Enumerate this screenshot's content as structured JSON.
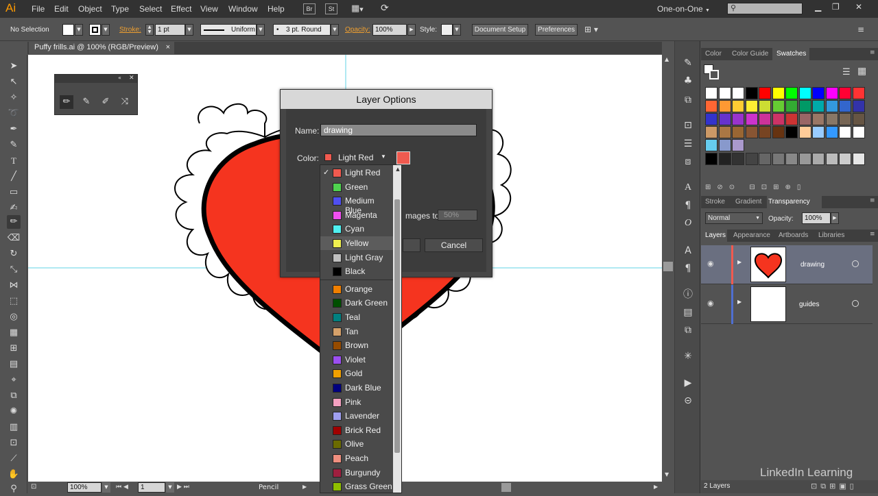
{
  "app": {
    "logo": "Ai"
  },
  "menu": [
    "File",
    "Edit",
    "Object",
    "Type",
    "Select",
    "Effect",
    "View",
    "Window",
    "Help"
  ],
  "menu_badges": [
    "Br",
    "St"
  ],
  "workspace": "One-on-One",
  "control": {
    "selection": "No Selection",
    "stroke_label": "Stroke:",
    "stroke_weight": "1 pt",
    "profile": "Uniform",
    "brush": "3 pt. Round",
    "opacity_label": "Opacity:",
    "opacity": "100%",
    "style_label": "Style:",
    "doc_setup": "Document Setup",
    "preferences": "Preferences"
  },
  "document_tab": {
    "title": "Puffy frills.ai @ 100% (RGB/Preview)",
    "close": "×"
  },
  "dialog": {
    "title": "Layer Options",
    "name_label": "Name:",
    "name_value": "drawing",
    "color_label": "Color:",
    "color_value": "Light Red",
    "color_hex": "#f05a4f",
    "dim_label": "mages to:",
    "dim_value": "50%",
    "cancel": "Cancel"
  },
  "color_list": {
    "selected": "Light Red",
    "hovered": "Yellow",
    "group1": [
      {
        "label": "Light Red",
        "color": "#f05a4f"
      },
      {
        "label": "Green",
        "color": "#4fd34f"
      },
      {
        "label": "Medium Blue",
        "color": "#4f4ff0"
      },
      {
        "label": "Magenta",
        "color": "#f04ff0"
      },
      {
        "label": "Cyan",
        "color": "#4ff0f0"
      },
      {
        "label": "Yellow",
        "color": "#f0f04f"
      },
      {
        "label": "Light Gray",
        "color": "#c0c0c0"
      },
      {
        "label": "Black",
        "color": "#000000"
      }
    ],
    "group2": [
      {
        "label": "Orange",
        "color": "#f07f00"
      },
      {
        "label": "Dark Green",
        "color": "#004f00"
      },
      {
        "label": "Teal",
        "color": "#008080"
      },
      {
        "label": "Tan",
        "color": "#d4a06a"
      },
      {
        "label": "Brown",
        "color": "#964b00"
      },
      {
        "label": "Violet",
        "color": "#9b4ff0"
      },
      {
        "label": "Gold",
        "color": "#f0a000"
      },
      {
        "label": "Dark Blue",
        "color": "#00007f"
      },
      {
        "label": "Pink",
        "color": "#f4a0c0"
      },
      {
        "label": "Lavender",
        "color": "#9f9ff0"
      },
      {
        "label": "Brick Red",
        "color": "#a00000"
      },
      {
        "label": "Olive",
        "color": "#6b6b00"
      },
      {
        "label": "Peach",
        "color": "#f08f7f"
      },
      {
        "label": "Burgundy",
        "color": "#9f1f3f"
      },
      {
        "label": "Grass Green",
        "color": "#8fbf00"
      }
    ]
  },
  "panels": {
    "swatch_tabs": [
      "Color",
      "Color Guide",
      "Swatches"
    ],
    "transparency_tabs": [
      "Stroke",
      "Gradient",
      "Transparency"
    ],
    "blend_mode": "Normal",
    "opacity_label": "Opacity:",
    "opacity": "100%",
    "layer_tabs": [
      "Layers",
      "Appearance",
      "Artboards",
      "Libraries"
    ],
    "layers": [
      {
        "name": "drawing",
        "color": "#f05a4f"
      },
      {
        "name": "guides",
        "color": "#4f6fd0"
      }
    ],
    "layer_count": "2 Layers",
    "swatch_rows": [
      [
        "#ffffff",
        "#ffffff",
        "#ffffff",
        "#000000",
        "#ff0000",
        "#ffff00",
        "#00ff00",
        "#00ffff",
        "#0000ff",
        "#ff00ff",
        "#ff0033",
        "#ff3333"
      ],
      [
        "#ff6633",
        "#ff9933",
        "#ffcc33",
        "#ffee33",
        "#ccdd33",
        "#66cc33",
        "#33aa33",
        "#009966",
        "#00aaaa",
        "#3399dd",
        "#3366cc",
        "#3333aa"
      ],
      [
        "#3333cc",
        "#6633cc",
        "#9933cc",
        "#cc33cc",
        "#cc3399",
        "#cc3366",
        "#cc3333",
        "#996666",
        "#997766",
        "#887766",
        "#776655",
        "#665544"
      ],
      [
        "#cc9966",
        "#aa7744",
        "#996633",
        "#885533",
        "#774422",
        "#663311",
        "#000000",
        "#ffcc99",
        "#99ccff",
        "#3399ff",
        "#ffffff",
        "#ffffff"
      ],
      [
        "#66ccee",
        "#8899cc",
        "#aa99cc"
      ],
      [
        "#000000",
        "#222222",
        "#333333",
        "#444444",
        "#666666",
        "#777777",
        "#888888",
        "#999999",
        "#aaaaaa",
        "#bbbbbb",
        "#cccccc",
        "#e6e6e6"
      ]
    ]
  },
  "status": {
    "zoom": "100%",
    "artboard": "1",
    "tool": "Pencil"
  },
  "watermark": "LinkedIn Learning"
}
